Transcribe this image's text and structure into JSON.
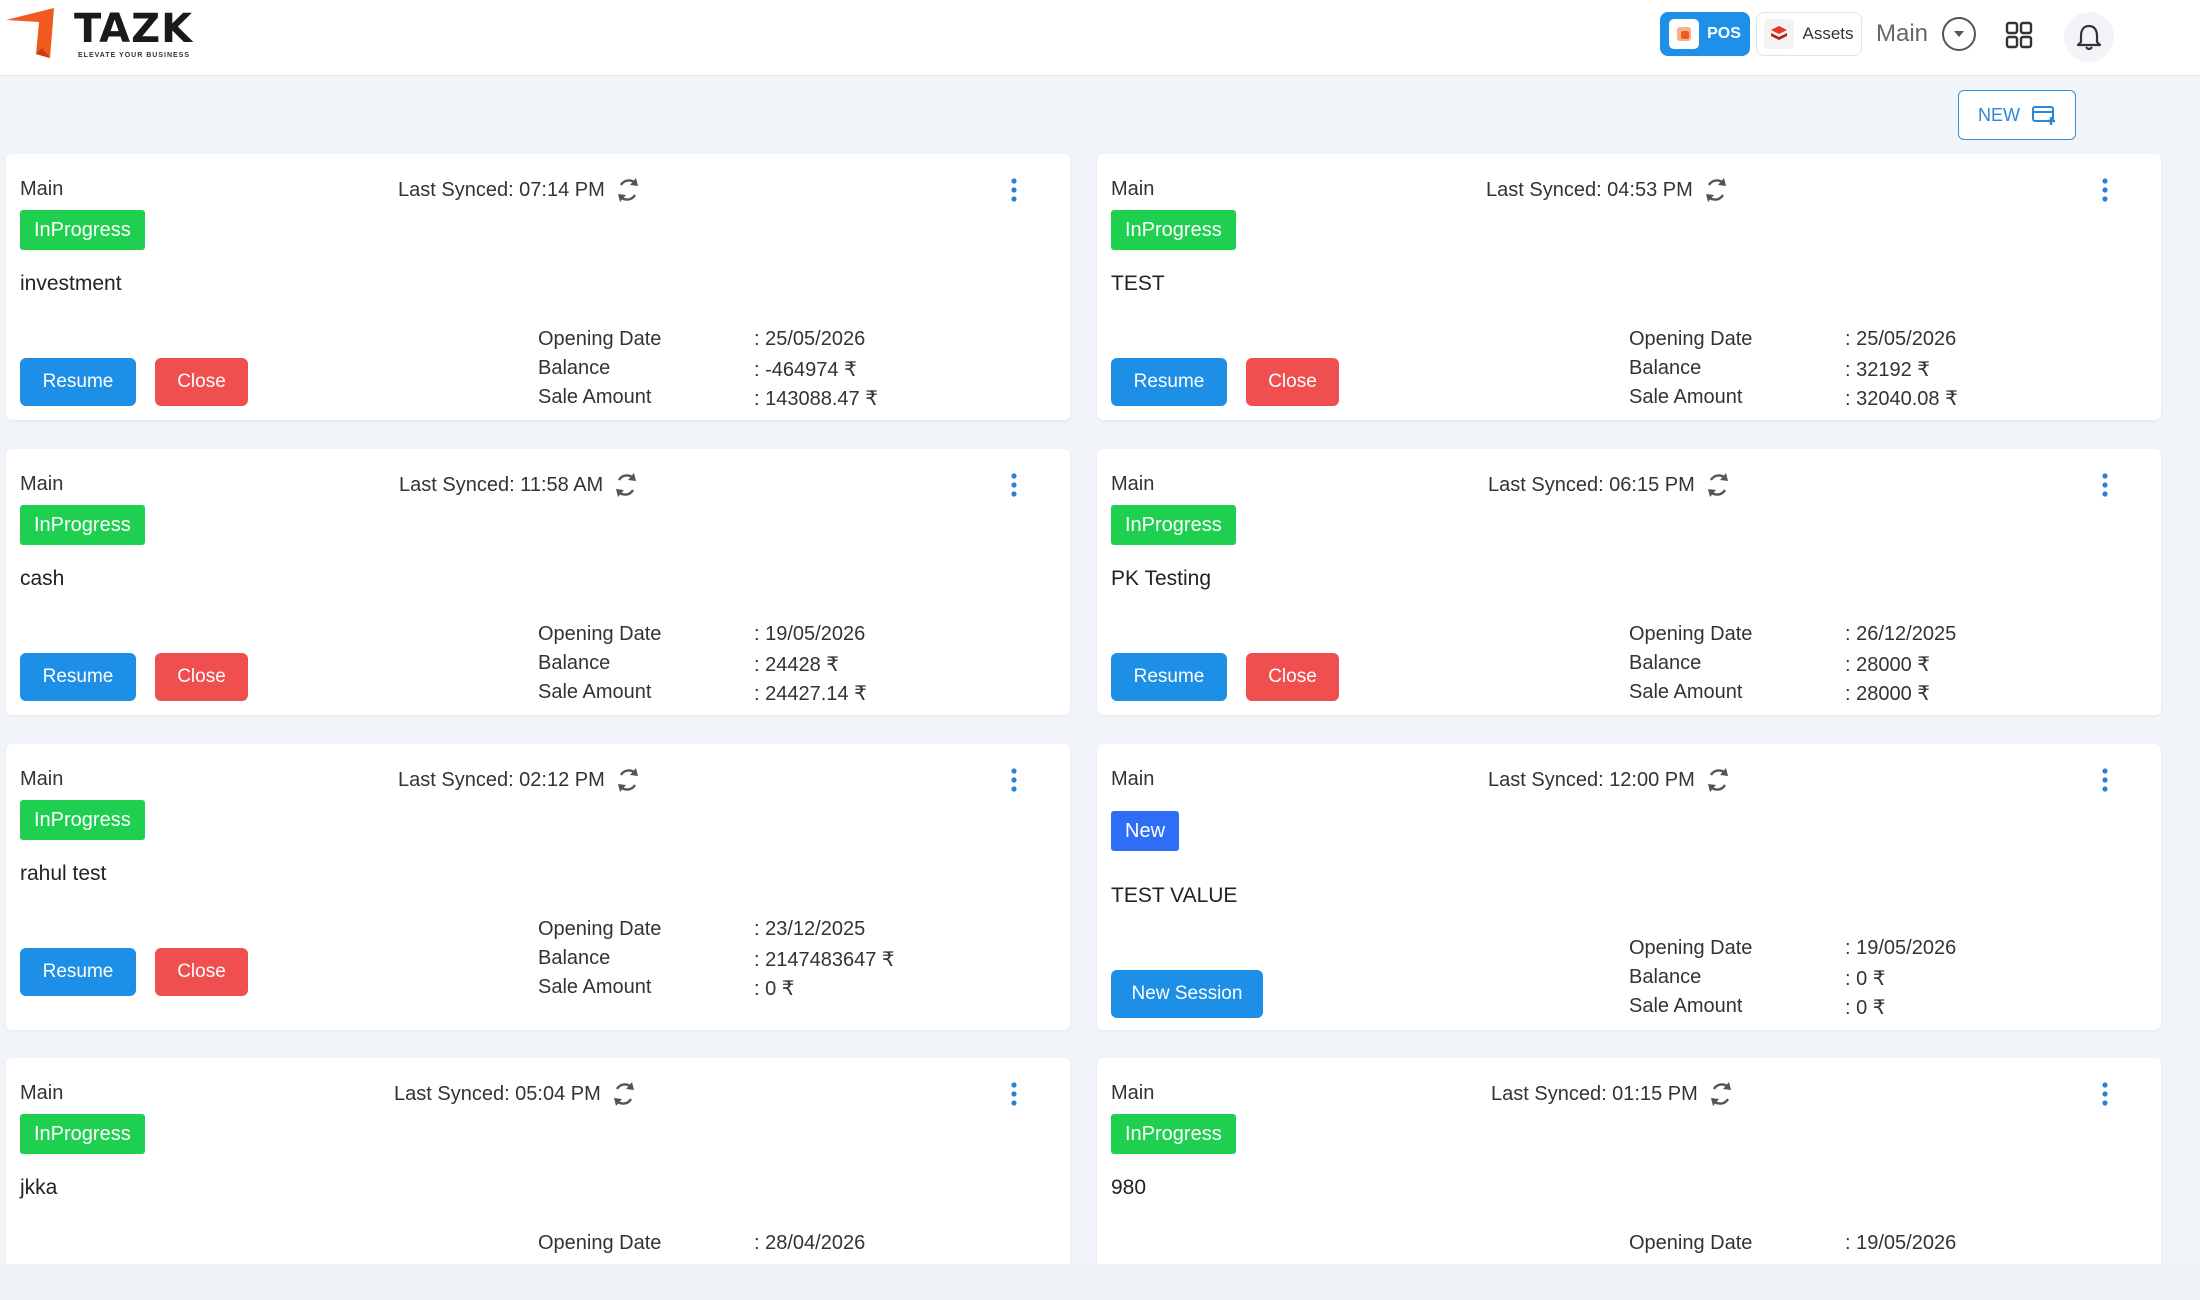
{
  "brand": {
    "name": "TAZK",
    "tagline": "ELEVATE YOUR BUSINESS",
    "accent": "#f05a1e"
  },
  "header": {
    "pos_label": "POS",
    "assets_label": "Assets",
    "branch_label": "Main"
  },
  "toolbar": {
    "new_label": "NEW"
  },
  "colors": {
    "primary": "#1e8fe6",
    "danger": "#f04f4f",
    "inprogress": "#1fcf4f",
    "new": "#2e6ef7"
  },
  "labels": {
    "opening_date": "Opening Date",
    "balance": "Balance",
    "sale_amount": "Sale Amount",
    "resume": "Resume",
    "close": "Close",
    "new_session": "New Session"
  },
  "sessions": [
    {
      "branch": "Main",
      "last_synced": "Last Synced: 07:14 PM",
      "status": "InProgress",
      "name": "investment",
      "opening_date": ": 25/05/2026",
      "balance": ": -464974 ₹",
      "sale_amount": ": 143088.47 ₹"
    },
    {
      "branch": "Main",
      "last_synced": "Last Synced: 04:53 PM",
      "status": "InProgress",
      "name": "TEST",
      "opening_date": ": 25/05/2026",
      "balance": ": 32192 ₹",
      "sale_amount": ": 32040.08 ₹"
    },
    {
      "branch": "Main",
      "last_synced": "Last Synced: 11:58 AM",
      "status": "InProgress",
      "name": "cash",
      "opening_date": ": 19/05/2026",
      "balance": ": 24428 ₹",
      "sale_amount": ": 24427.14 ₹"
    },
    {
      "branch": "Main",
      "last_synced": "Last Synced: 06:15 PM",
      "status": "InProgress",
      "name": "PK Testing",
      "opening_date": ": 26/12/2025",
      "balance": ": 28000 ₹",
      "sale_amount": ": 28000 ₹"
    },
    {
      "branch": "Main",
      "last_synced": "Last Synced: 02:12 PM",
      "status": "InProgress",
      "name": "rahul test",
      "opening_date": ": 23/12/2025",
      "balance": ": 2147483647 ₹",
      "sale_amount": ": 0 ₹"
    },
    {
      "branch": "Main",
      "last_synced": "Last Synced: 12:00 PM",
      "status": "New",
      "name": "TEST VALUE",
      "opening_date": ": 19/05/2026",
      "balance": ": 0 ₹",
      "sale_amount": ": 0 ₹"
    },
    {
      "branch": "Main",
      "last_synced": "Last Synced: 05:04 PM",
      "status": "InProgress",
      "name": "jkka",
      "opening_date": ": 28/04/2026"
    },
    {
      "branch": "Main",
      "last_synced": "Last Synced: 01:15 PM",
      "status": "InProgress",
      "name": "980",
      "opening_date": ": 19/05/2026"
    }
  ]
}
